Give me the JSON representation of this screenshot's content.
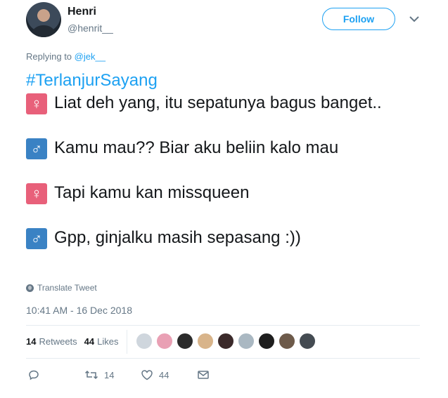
{
  "author": {
    "name": "Henri",
    "handle": "@henrit__"
  },
  "follow_label": "Follow",
  "replying": {
    "prefix": "Replying to ",
    "mention": "@jek__"
  },
  "tweet": {
    "hashtag": "#TerlanjurSayang",
    "lines": [
      {
        "symbol": "♀",
        "symbol_color": "#e8607a",
        "text": "Liat deh yang, itu sepatunya bagus banget.."
      },
      {
        "symbol": "♂",
        "symbol_color": "#3a82c4",
        "text": "Kamu mau?? Biar aku beliin kalo mau"
      },
      {
        "symbol": "♀",
        "symbol_color": "#e8607a",
        "text": "Tapi kamu kan missqueen"
      },
      {
        "symbol": "♂",
        "symbol_color": "#3a82c4",
        "text": "Gpp, ginjalku masih sepasang :))"
      }
    ]
  },
  "translate_label": "Translate Tweet",
  "timestamp": "10:41 AM - 16 Dec 2018",
  "stats": {
    "retweets_count": "14",
    "retweets_label": "Retweets",
    "likes_count": "44",
    "likes_label": "Likes"
  },
  "liker_avatar_colors": [
    "#cfd6dd",
    "#e9a0b4",
    "#2b2b2b",
    "#d8b48a",
    "#3b2a2a",
    "#aab8c2",
    "#1e1e1e",
    "#6d5a4a",
    "#444b52"
  ],
  "actions": {
    "reply_icon": "reply-icon",
    "retweet_count": "14",
    "like_count": "44",
    "dm_icon": "envelope-icon"
  },
  "colors": {
    "accent": "#1da1f2",
    "muted": "#657786",
    "text": "#14171a"
  }
}
